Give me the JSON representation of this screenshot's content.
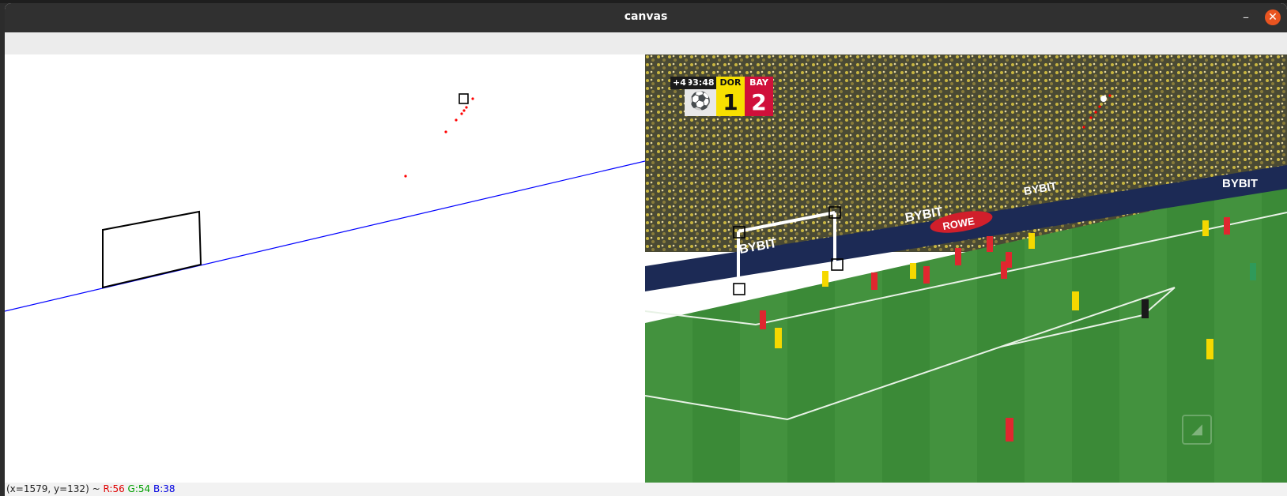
{
  "window": {
    "title": "canvas",
    "minimize_label": "–",
    "close_label": "✕"
  },
  "status": {
    "coords": "(x=1579, y=132) ~",
    "r": "R:56",
    "g": "G:54",
    "b": "B:38",
    "r_color": "#e00000",
    "g_color": "#00a000",
    "b_color": "#0000e0"
  },
  "scoreboard": {
    "extra_time": "+4",
    "clock": "93:48",
    "home_abbr": "DOR",
    "home_score": "1",
    "home_color": "#f7e000",
    "away_abbr": "BAY",
    "away_score": "2",
    "away_color": "#d0103a"
  },
  "colors": {
    "pitch": "#3f8f3b",
    "home_kit": "#f5d800",
    "away_kit": "#e0272f",
    "horizon_line": "#0000ff",
    "trajectory": "#ff0000"
  }
}
